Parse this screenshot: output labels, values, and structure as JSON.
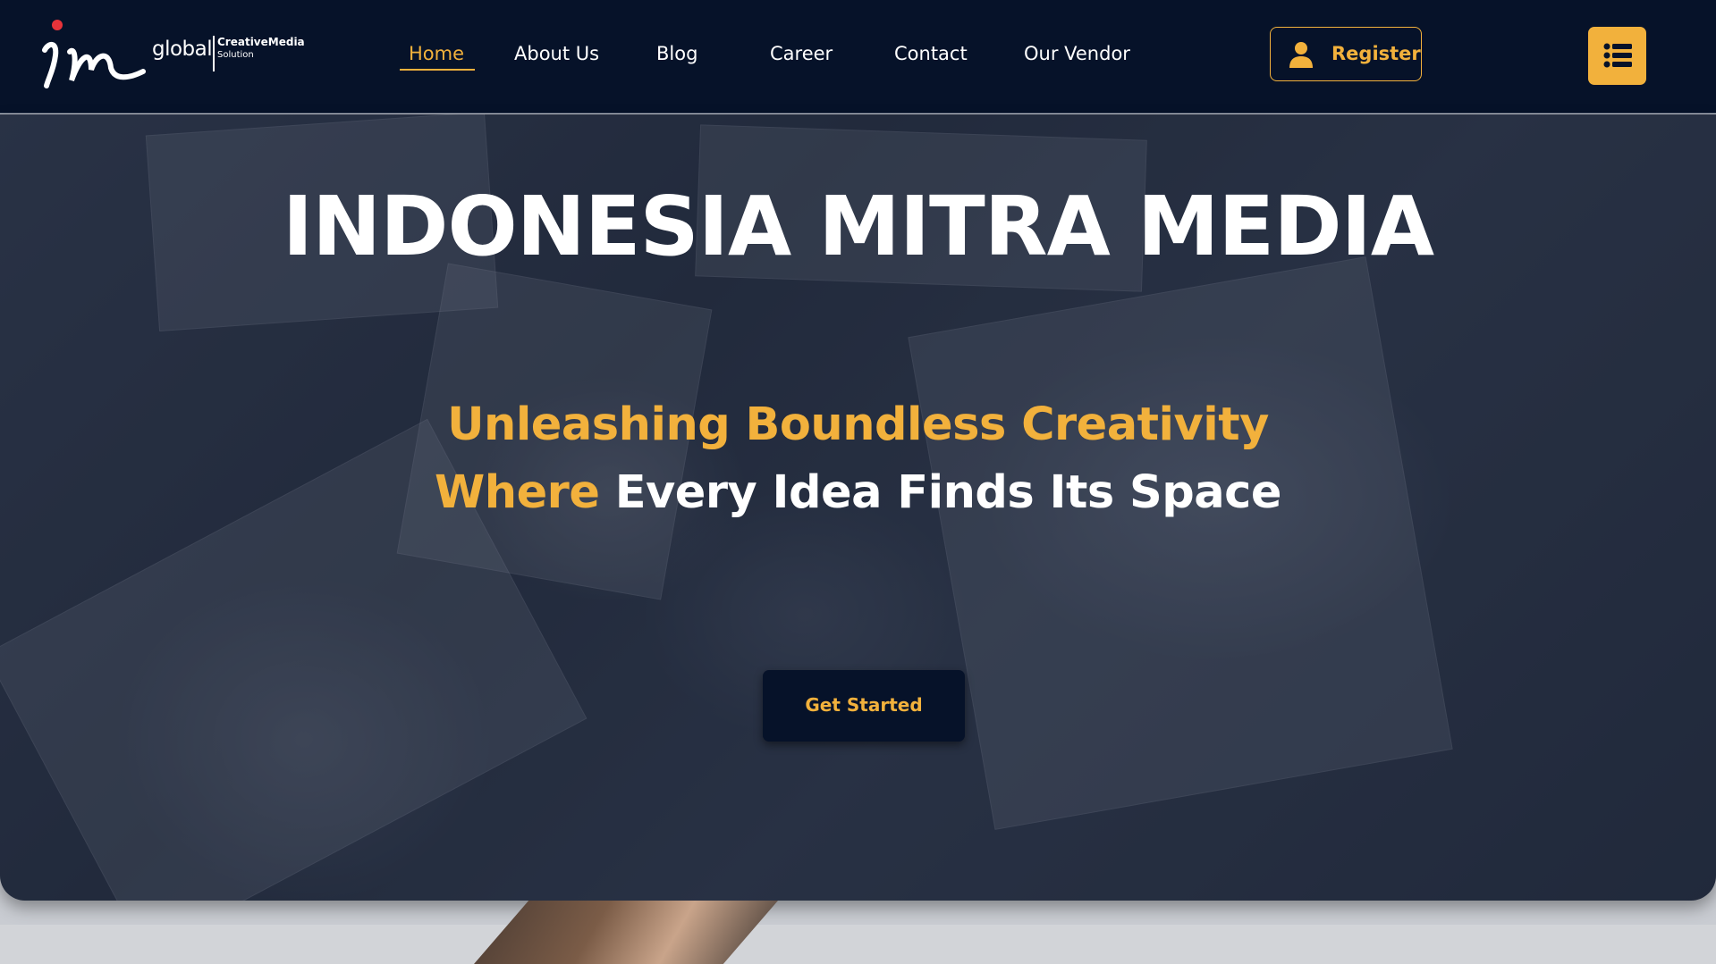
{
  "brand": {
    "logo_word": "global",
    "logo_sub1": "CreativeMedia",
    "logo_sub2": "Solution",
    "logo_icon": "im-script-logo",
    "accent_color": "#f2b13c",
    "dark_color": "#061229"
  },
  "nav": {
    "items": [
      {
        "label": "Home",
        "active": true
      },
      {
        "label": "About Us"
      },
      {
        "label": "Blog"
      },
      {
        "label": "Career"
      },
      {
        "label": "Contact"
      },
      {
        "label": "Our Vendor"
      }
    ],
    "register_label": "Register",
    "register_icon": "user-icon",
    "menu_icon": "list-icon"
  },
  "hero": {
    "title": "INDONESIA MITRA MEDIA",
    "tagline_line1": "Unleashing Boundless Creativity",
    "tagline_line2_accent": "Where",
    "tagline_line2_rest": "Every Idea Finds Its Space",
    "cta_label": "Get Started",
    "scroll_top_icon": "chevron-up-icon"
  }
}
